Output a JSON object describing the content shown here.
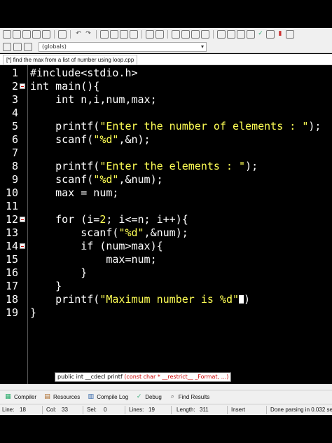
{
  "window": {
    "globals_value": "(globals)",
    "file_tab": "[*] find the max from a list of number using loop.cpp"
  },
  "toolbar_icons": [
    "new-file-icon",
    "open-icon",
    "save-icon",
    "save-all-icon",
    "close-icon",
    "print-icon",
    "undo-icon",
    "redo-icon",
    "search-icon",
    "replace-icon",
    "find-next-icon",
    "goto-icon",
    "indent-icon",
    "unindent-icon",
    "toggle-comment-icon",
    "bookmark-icon",
    "compile-icon",
    "run-icon",
    "compile-run-icon",
    "rebuild-icon",
    "debug-icon",
    "chart-icon",
    "stop-icon"
  ],
  "editor": {
    "line_numbers": [
      "1",
      "2",
      "3",
      "4",
      "5",
      "6",
      "7",
      "8",
      "9",
      "10",
      "11",
      "12",
      "13",
      "14",
      "15",
      "16",
      "17",
      "18",
      "19"
    ],
    "lines": [
      {
        "indent": "",
        "parts": [
          {
            "t": "#include<stdio.h>",
            "c": "kw"
          }
        ]
      },
      {
        "indent": "",
        "parts": [
          {
            "t": "int main(){",
            "c": "kw"
          }
        ]
      },
      {
        "indent": "    ",
        "parts": [
          {
            "t": "int n,i,num,max;",
            "c": "kw"
          }
        ]
      },
      {
        "indent": "",
        "parts": []
      },
      {
        "indent": "    ",
        "parts": [
          {
            "t": "printf(",
            "c": "kw"
          },
          {
            "t": "\"Enter the number of elements : \"",
            "c": "str"
          },
          {
            "t": ");",
            "c": "kw"
          }
        ]
      },
      {
        "indent": "    ",
        "parts": [
          {
            "t": "scanf(",
            "c": "kw"
          },
          {
            "t": "\"%d\"",
            "c": "str"
          },
          {
            "t": ",&n);",
            "c": "kw"
          }
        ]
      },
      {
        "indent": "",
        "parts": []
      },
      {
        "indent": "    ",
        "parts": [
          {
            "t": "printf(",
            "c": "kw"
          },
          {
            "t": "\"Enter the elements : \"",
            "c": "str"
          },
          {
            "t": ");",
            "c": "kw"
          }
        ]
      },
      {
        "indent": "    ",
        "parts": [
          {
            "t": "scanf(",
            "c": "kw"
          },
          {
            "t": "\"%d\"",
            "c": "str"
          },
          {
            "t": ",&num);",
            "c": "kw"
          }
        ]
      },
      {
        "indent": "    ",
        "parts": [
          {
            "t": "max = num;",
            "c": "kw"
          }
        ]
      },
      {
        "indent": "",
        "parts": []
      },
      {
        "indent": "    ",
        "parts": [
          {
            "t": "for (i=",
            "c": "kw"
          },
          {
            "t": "2",
            "c": "num"
          },
          {
            "t": "; i<=n; i++){",
            "c": "kw"
          }
        ]
      },
      {
        "indent": "        ",
        "parts": [
          {
            "t": "scanf(",
            "c": "kw"
          },
          {
            "t": "\"%d\"",
            "c": "str"
          },
          {
            "t": ",&num);",
            "c": "kw"
          }
        ]
      },
      {
        "indent": "        ",
        "parts": [
          {
            "t": "if (num>max){",
            "c": "kw"
          }
        ]
      },
      {
        "indent": "            ",
        "parts": [
          {
            "t": "max=num;",
            "c": "kw"
          }
        ]
      },
      {
        "indent": "        ",
        "parts": [
          {
            "t": "}",
            "c": "kw"
          }
        ]
      },
      {
        "indent": "    ",
        "parts": [
          {
            "t": "}",
            "c": "kw"
          }
        ]
      },
      {
        "indent": "    ",
        "parts": [
          {
            "t": "printf(",
            "c": "kw"
          },
          {
            "t": "\"Maximum number is %d\"",
            "c": "str"
          },
          {
            "t": ")",
            "c": "kw"
          }
        ]
      },
      {
        "indent": "",
        "parts": [
          {
            "t": "}",
            "c": "kw"
          }
        ]
      }
    ],
    "fold_lines": [
      2,
      12,
      14
    ],
    "tooltip": {
      "prefix": "public int __cdecl printf ",
      "params": "(const char * __restrict__ _Format, ...)"
    }
  },
  "bottom_tabs": [
    {
      "icon": "compiler-icon",
      "label": "Compiler"
    },
    {
      "icon": "resources-icon",
      "label": "Resources"
    },
    {
      "icon": "compile-log-icon",
      "label": "Compile Log"
    },
    {
      "icon": "debug-icon",
      "label": "Debug"
    },
    {
      "icon": "find-results-icon",
      "label": "Find Results"
    }
  ],
  "status": {
    "line_label": "Line:",
    "line_value": "18",
    "col_label": "Col:",
    "col_value": "33",
    "sel_label": "Sel:",
    "sel_value": "0",
    "lines_label": "Lines:",
    "lines_value": "19",
    "length_label": "Length:",
    "length_value": "311",
    "mode": "Insert",
    "message": "Done parsing in 0.032 se"
  },
  "colors": {
    "editor_bg": "#000000",
    "string": "#ffff55",
    "text": "#ffffff"
  }
}
